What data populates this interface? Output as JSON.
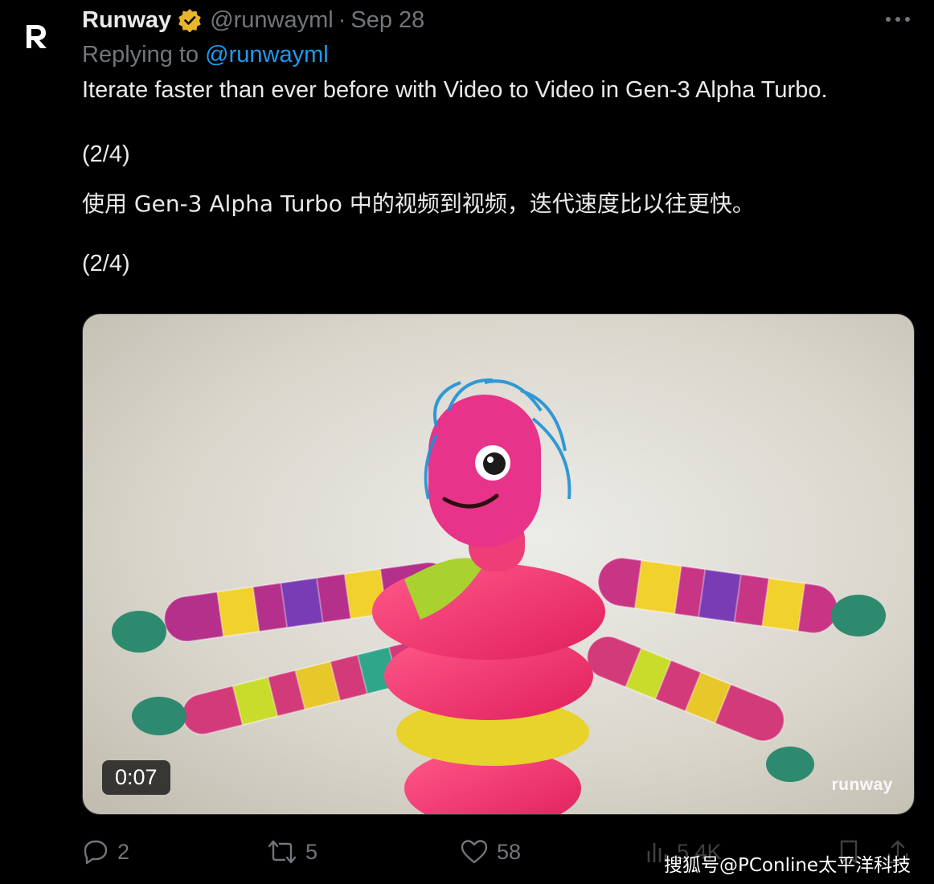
{
  "author": {
    "name": "Runway",
    "handle": "@runwayml",
    "separator": "·",
    "date": "Sep 28",
    "avatar_icon": "runway-logo-icon",
    "verified_icon": "verified-gold-badge-icon",
    "verified_color": "#e8b62c"
  },
  "reply": {
    "prefix": "Replying to",
    "target": "@runwayml"
  },
  "tweet": {
    "line1": "Iterate faster than ever before with Video to Video in Gen-3 Alpha Turbo.",
    "line2": "(2/4)",
    "line3": "使用 Gen-3 Alpha Turbo 中的视频到视频，迭代速度比以往更快。",
    "line4": "(2/4)"
  },
  "media": {
    "duration": "0:07",
    "watermark": "runway"
  },
  "actions": {
    "reply_count": "2",
    "retweet_count": "5",
    "like_count": "58",
    "views_count": "5.4K",
    "reply_icon": "reply-bubble-icon",
    "retweet_icon": "retweet-icon",
    "like_icon": "heart-icon",
    "views_icon": "views-bar-chart-icon",
    "bookmark_icon": "bookmark-icon",
    "share_icon": "share-upload-icon"
  },
  "overlay": {
    "source": "搜狐号@PConline太平洋科技"
  },
  "colors": {
    "background": "#000000",
    "text": "#e7e9ea",
    "muted": "#71767b",
    "link": "#1d9bf0"
  }
}
